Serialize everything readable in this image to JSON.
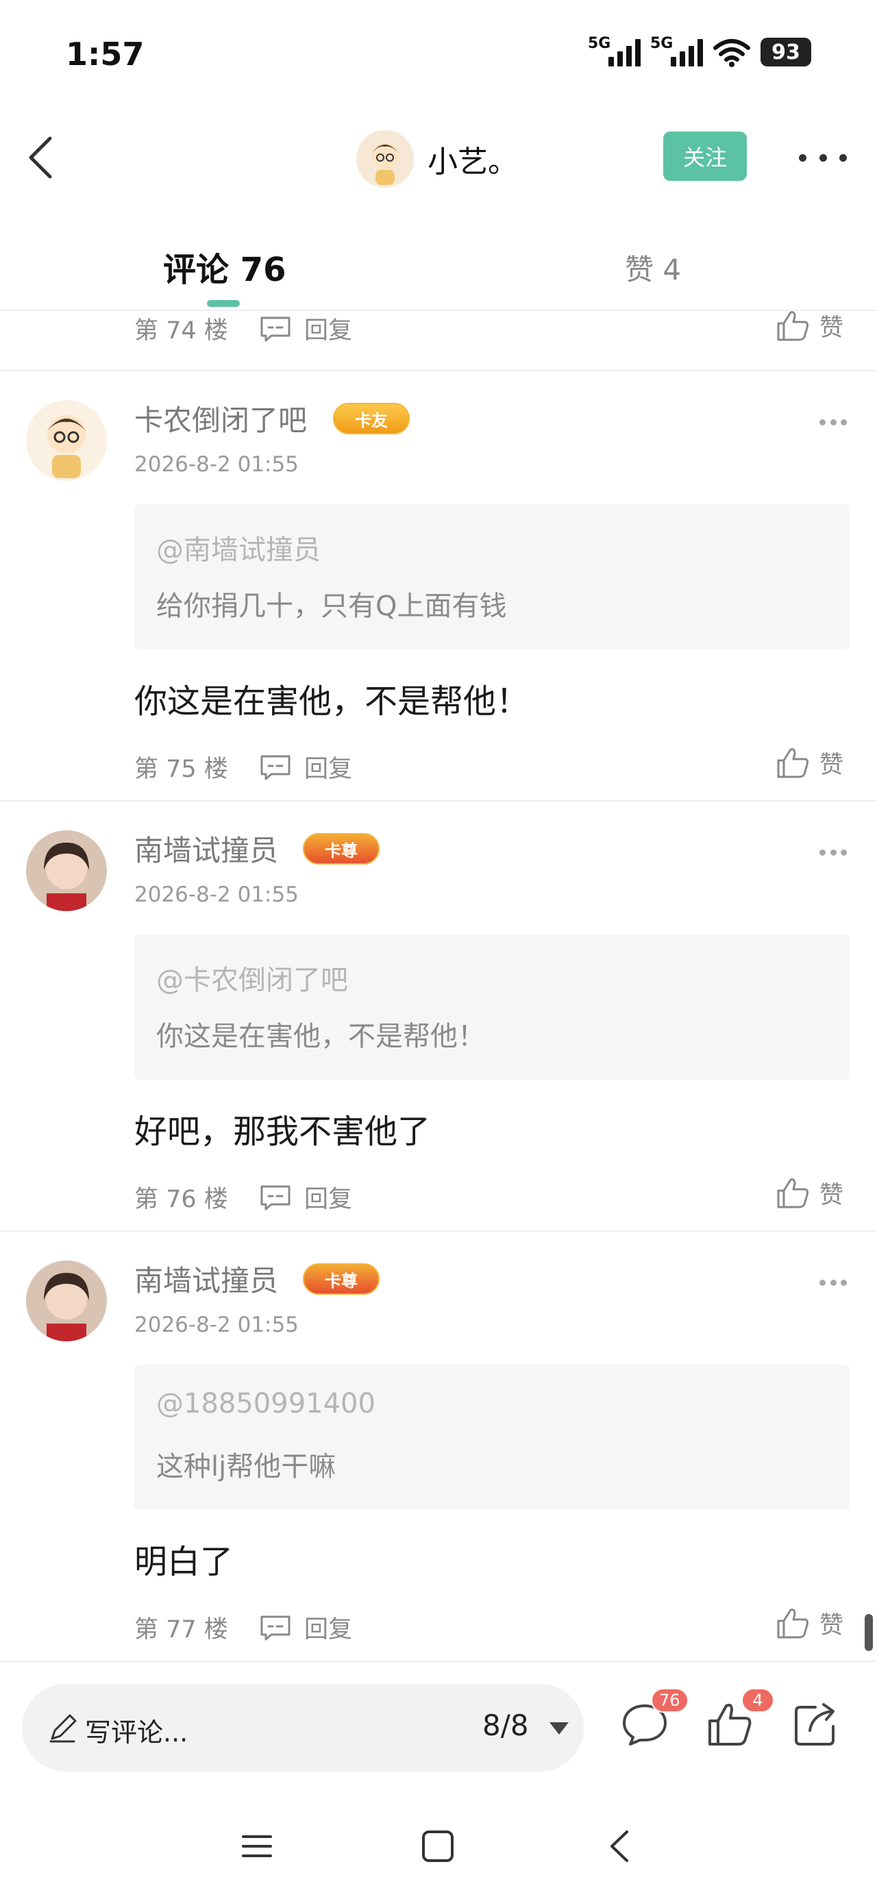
{
  "status_bar": {
    "time": "1:57",
    "network_1": "5G",
    "network_2": "5G",
    "battery": "93"
  },
  "header": {
    "username": "小艺。",
    "follow_label": "关注"
  },
  "tabs": {
    "comments_label": "评论 76",
    "likes_label": "赞 4"
  },
  "partial_row": {
    "floor": "第 74 楼",
    "reply": "回复",
    "like": "赞"
  },
  "comments": [
    {
      "name": "卡农倒闭了吧",
      "badge": "卡友",
      "time": "2026-8-2 01:55",
      "quote_at": "@南墙试撞员",
      "quote_text": "给你捐几十，只有Q上面有钱",
      "text": "你这是在害他，不是帮他！",
      "floor": "第 75 楼",
      "reply": "回复",
      "like": "赞"
    },
    {
      "name": "南墙试撞员",
      "badge": "卡尊",
      "time": "2026-8-2 01:55",
      "quote_at": "@卡农倒闭了吧",
      "quote_text": "你这是在害他，不是帮他！",
      "text": "好吧，那我不害他了",
      "floor": "第 76 楼",
      "reply": "回复",
      "like": "赞"
    },
    {
      "name": "南墙试撞员",
      "badge": "卡尊",
      "time": "2026-8-2 01:55",
      "quote_at": "@18850991400",
      "quote_text": "这种lj帮他干嘛",
      "text": "明白了",
      "floor": "第 77 楼",
      "reply": "回复",
      "like": "赞"
    }
  ],
  "bottom_bar": {
    "write_placeholder": "写评论...",
    "page_indicator": "8/8",
    "comment_count": "76",
    "like_count": "4"
  },
  "colors": {
    "accent": "#5cc2a4",
    "badge_red": "#ee6a61"
  },
  "icons": [
    "back-arrow-icon",
    "more-dots-icon",
    "reply-icon",
    "thumbs-up-icon",
    "pencil-icon",
    "comment-bubble-icon",
    "share-icon",
    "menu-icon",
    "home-square-icon",
    "back-nav-icon"
  ]
}
